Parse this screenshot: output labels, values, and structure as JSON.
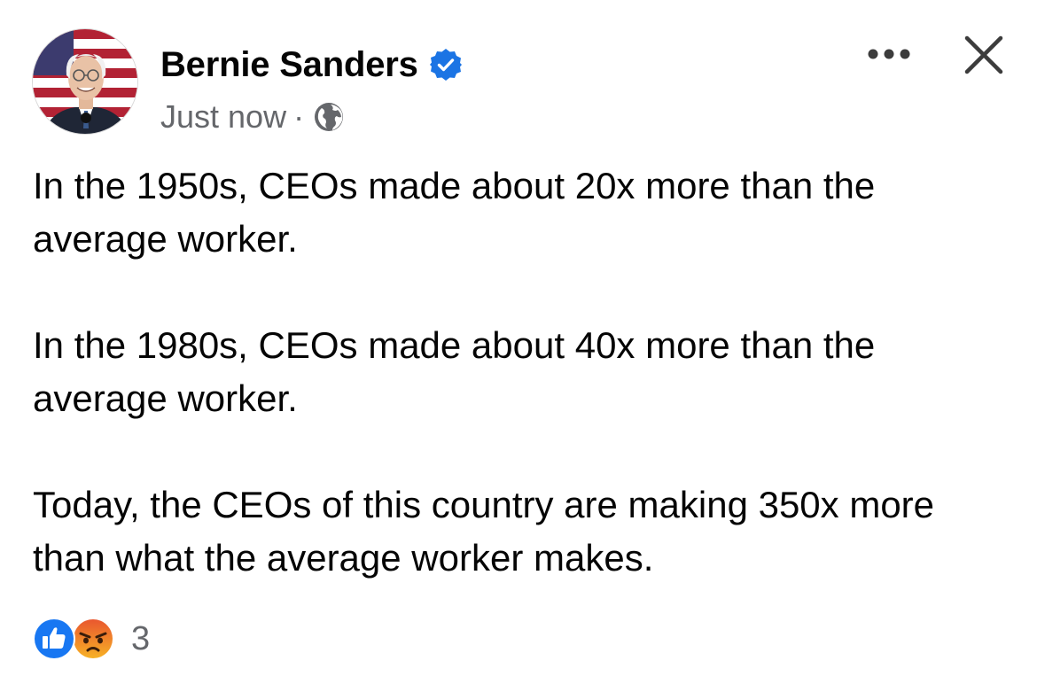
{
  "post": {
    "author": "Bernie Sanders",
    "timestamp": "Just now",
    "separator": "·",
    "audience_icon": "globe-icon",
    "verified_icon": "verified-badge-icon",
    "paragraphs": [
      "In the 1950s, CEOs made about 20x more than the average worker.",
      "In the 1980s, CEOs made about 40x more than the average worker.",
      "Today, the CEOs of this country are making 350x more than what the average worker makes."
    ],
    "reactions": {
      "types": [
        "like-icon",
        "angry-icon"
      ],
      "count": "3"
    }
  },
  "header": {
    "more_icon": "more-options-icon",
    "close_icon": "close-icon"
  },
  "colors": {
    "text": "#050505",
    "secondary_text": "#65676b",
    "verified_blue": "#1b74e4",
    "like_blue": "#1877f2",
    "angry_orange": "#f5832a",
    "icon_dark": "#333333"
  }
}
